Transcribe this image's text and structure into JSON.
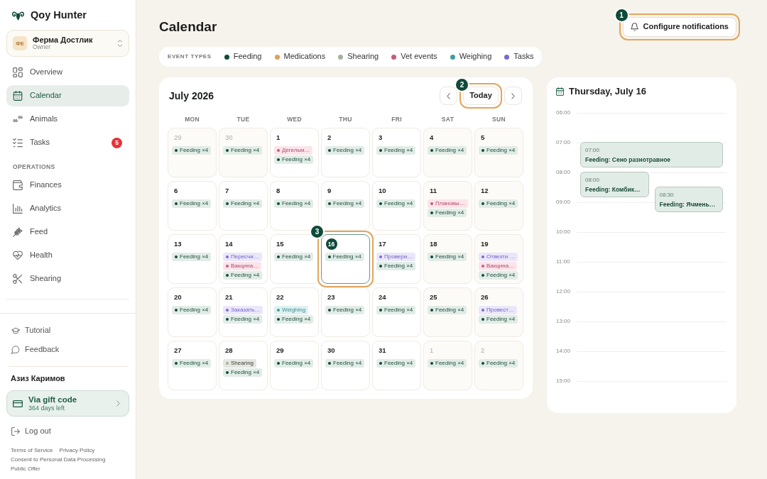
{
  "sidebar": {
    "brand": "Qoy Hunter",
    "farm": {
      "initials": "ФЕ",
      "name": "Ферма Достлик",
      "role": "Owner"
    },
    "nav": [
      {
        "label": "Overview",
        "selected": false
      },
      {
        "label": "Calendar",
        "selected": true
      },
      {
        "label": "Animals",
        "selected": false
      },
      {
        "label": "Tasks",
        "selected": false,
        "badge": "5"
      }
    ],
    "section_label": "OPERATIONS",
    "operations": [
      {
        "label": "Finances",
        "selected": false
      },
      {
        "label": "Analytics",
        "selected": false
      },
      {
        "label": "Feed",
        "selected": false
      },
      {
        "label": "Health",
        "selected": false
      },
      {
        "label": "Shearing",
        "selected": false
      }
    ],
    "help_links": [
      "Tutorial",
      "Feedback"
    ],
    "user_name": "Азиз Каримов",
    "subscription": {
      "title": "Via gift code",
      "subtitle": "364 days left"
    },
    "logout": "Log out",
    "legal_links": [
      "Terms of Service",
      "Privacy Policy",
      "Consent to Personal Data Processing",
      "Public Offer"
    ]
  },
  "page": {
    "title": "Calendar",
    "notify_button": {
      "label": "Configure notifications",
      "callout": "1"
    }
  },
  "legend": {
    "label": "EVENT TYPES",
    "items": [
      {
        "kind": "feeding",
        "label": "Feeding",
        "color": "#0f4a3a"
      },
      {
        "kind": "medication",
        "label": "Medications",
        "color": "#dca15c"
      },
      {
        "kind": "shearing",
        "label": "Shearing",
        "color": "#a4b29b"
      },
      {
        "kind": "vet",
        "label": "Vet events",
        "color": "#c75a80"
      },
      {
        "kind": "weighing",
        "label": "Weighing",
        "color": "#3f9ea3"
      },
      {
        "kind": "task",
        "label": "Tasks",
        "color": "#7c69cf"
      }
    ]
  },
  "calendar": {
    "month": "July 2026",
    "today_button": {
      "label": "Today",
      "callout": "2"
    },
    "weekdays": [
      "MON",
      "TUE",
      "WED",
      "THU",
      "FRI",
      "SAT",
      "SUN"
    ],
    "days": [
      {
        "day": "29",
        "outside": true,
        "today": false,
        "events": [
          {
            "kind": "feeding",
            "text": "Feeding ×4"
          }
        ]
      },
      {
        "day": "30",
        "outside": true,
        "today": false,
        "events": [
          {
            "kind": "feeding",
            "text": "Feeding ×4"
          }
        ]
      },
      {
        "day": "1",
        "outside": false,
        "today": false,
        "events": [
          {
            "kind": "vet",
            "text": "Дегельм…"
          },
          {
            "kind": "feeding",
            "text": "Feeding ×4"
          }
        ]
      },
      {
        "day": "2",
        "outside": false,
        "today": false,
        "events": [
          {
            "kind": "feeding",
            "text": "Feeding ×4"
          }
        ]
      },
      {
        "day": "3",
        "outside": false,
        "today": false,
        "events": [
          {
            "kind": "feeding",
            "text": "Feeding ×4"
          }
        ]
      },
      {
        "day": "4",
        "outside": false,
        "today": false,
        "events": [
          {
            "kind": "feeding",
            "text": "Feeding ×4"
          }
        ]
      },
      {
        "day": "5",
        "outside": false,
        "today": false,
        "events": [
          {
            "kind": "feeding",
            "text": "Feeding ×4"
          }
        ]
      },
      {
        "day": "6",
        "outside": false,
        "today": false,
        "events": [
          {
            "kind": "feeding",
            "text": "Feeding ×4"
          }
        ]
      },
      {
        "day": "7",
        "outside": false,
        "today": false,
        "events": [
          {
            "kind": "feeding",
            "text": "Feeding ×4"
          }
        ]
      },
      {
        "day": "8",
        "outside": false,
        "today": false,
        "events": [
          {
            "kind": "feeding",
            "text": "Feeding ×4"
          }
        ]
      },
      {
        "day": "9",
        "outside": false,
        "today": false,
        "events": [
          {
            "kind": "feeding",
            "text": "Feeding ×4"
          }
        ]
      },
      {
        "day": "10",
        "outside": false,
        "today": false,
        "events": [
          {
            "kind": "feeding",
            "text": "Feeding ×4"
          }
        ]
      },
      {
        "day": "11",
        "outside": false,
        "today": false,
        "events": [
          {
            "kind": "vet",
            "text": "Плановы…"
          },
          {
            "kind": "feeding",
            "text": "Feeding ×4"
          }
        ]
      },
      {
        "day": "12",
        "outside": false,
        "today": false,
        "events": [
          {
            "kind": "feeding",
            "text": "Feeding ×4"
          }
        ]
      },
      {
        "day": "13",
        "outside": false,
        "today": false,
        "events": [
          {
            "kind": "feeding",
            "text": "Feeding ×4"
          }
        ]
      },
      {
        "day": "14",
        "outside": false,
        "today": false,
        "events": [
          {
            "kind": "task",
            "text": "Пересчи…"
          },
          {
            "kind": "vet",
            "text": "Вакцина…"
          },
          {
            "kind": "feeding",
            "text": "Feeding ×4"
          }
        ]
      },
      {
        "day": "15",
        "outside": false,
        "today": false,
        "events": [
          {
            "kind": "feeding",
            "text": "Feeding ×4"
          }
        ]
      },
      {
        "day": "16",
        "outside": false,
        "today": true,
        "callout": "3",
        "events": [
          {
            "kind": "feeding",
            "text": "Feeding ×4"
          }
        ]
      },
      {
        "day": "17",
        "outside": false,
        "today": false,
        "events": [
          {
            "kind": "task",
            "text": "Провери…"
          },
          {
            "kind": "feeding",
            "text": "Feeding ×4"
          }
        ]
      },
      {
        "day": "18",
        "outside": false,
        "today": false,
        "events": [
          {
            "kind": "feeding",
            "text": "Feeding ×4"
          }
        ]
      },
      {
        "day": "19",
        "outside": false,
        "today": false,
        "events": [
          {
            "kind": "task",
            "text": "Отвезти …"
          },
          {
            "kind": "vet",
            "text": "Вакцина…"
          },
          {
            "kind": "feeding",
            "text": "Feeding ×4"
          }
        ]
      },
      {
        "day": "20",
        "outside": false,
        "today": false,
        "events": [
          {
            "kind": "feeding",
            "text": "Feeding ×4"
          }
        ]
      },
      {
        "day": "21",
        "outside": false,
        "today": false,
        "events": [
          {
            "kind": "task",
            "text": "Заказать…"
          },
          {
            "kind": "feeding",
            "text": "Feeding ×4"
          }
        ]
      },
      {
        "day": "22",
        "outside": false,
        "today": false,
        "events": [
          {
            "kind": "weighing",
            "text": "Weighing"
          },
          {
            "kind": "feeding",
            "text": "Feeding ×4"
          }
        ]
      },
      {
        "day": "23",
        "outside": false,
        "today": false,
        "events": [
          {
            "kind": "feeding",
            "text": "Feeding ×4"
          }
        ]
      },
      {
        "day": "24",
        "outside": false,
        "today": false,
        "events": [
          {
            "kind": "feeding",
            "text": "Feeding ×4"
          }
        ]
      },
      {
        "day": "25",
        "outside": false,
        "today": false,
        "events": [
          {
            "kind": "feeding",
            "text": "Feeding ×4"
          }
        ]
      },
      {
        "day": "26",
        "outside": false,
        "today": false,
        "events": [
          {
            "kind": "task",
            "text": "Провест…"
          },
          {
            "kind": "feeding",
            "text": "Feeding ×4"
          }
        ]
      },
      {
        "day": "27",
        "outside": false,
        "today": false,
        "events": [
          {
            "kind": "feeding",
            "text": "Feeding ×4"
          }
        ]
      },
      {
        "day": "28",
        "outside": false,
        "today": false,
        "events": [
          {
            "kind": "shearing",
            "text": "Shearing"
          },
          {
            "kind": "feeding",
            "text": "Feeding ×4"
          }
        ]
      },
      {
        "day": "29",
        "outside": false,
        "today": false,
        "events": [
          {
            "kind": "feeding",
            "text": "Feeding ×4"
          }
        ]
      },
      {
        "day": "30",
        "outside": false,
        "today": false,
        "events": [
          {
            "kind": "feeding",
            "text": "Feeding ×4"
          }
        ]
      },
      {
        "day": "31",
        "outside": false,
        "today": false,
        "events": [
          {
            "kind": "feeding",
            "text": "Feeding ×4"
          }
        ]
      },
      {
        "day": "1",
        "outside": true,
        "today": false,
        "events": [
          {
            "kind": "feeding",
            "text": "Feeding ×4"
          }
        ]
      },
      {
        "day": "2",
        "outside": true,
        "today": false,
        "events": [
          {
            "kind": "feeding",
            "text": "Feeding ×4"
          }
        ]
      }
    ]
  },
  "day_panel": {
    "title": "Thursday, July 16",
    "hours": [
      "06:00",
      "07:00",
      "08:00",
      "09:00",
      "10:00",
      "11:00",
      "12:00",
      "13:00",
      "14:00",
      "15:00"
    ],
    "events": [
      {
        "kind": "feeding",
        "time": "07:00",
        "text": "Feeding: Сено разнотравное"
      },
      {
        "kind": "feeding",
        "time": "08:00",
        "text": "Feeding: Комбик…"
      },
      {
        "kind": "feeding",
        "time": "08:30",
        "text": "Feeding: Ячмень…"
      }
    ]
  }
}
